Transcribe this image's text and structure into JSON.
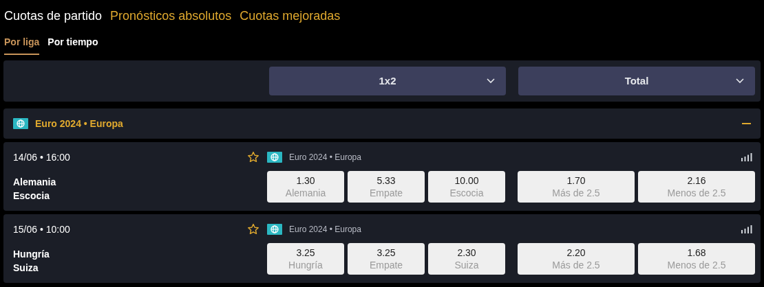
{
  "main_tabs": [
    {
      "label": "Cuotas de partido",
      "selected": true
    },
    {
      "label": "Pronósticos absolutos",
      "selected": false
    },
    {
      "label": "Cuotas mejoradas",
      "selected": false
    }
  ],
  "sub_tabs": [
    {
      "label": "Por liga",
      "selected": true
    },
    {
      "label": "Por tiempo",
      "selected": false
    }
  ],
  "market_selectors": [
    {
      "label": "1x2"
    },
    {
      "label": "Total"
    }
  ],
  "league": {
    "title": "Euro 2024 • Europa",
    "expanded": true
  },
  "matches": [
    {
      "datetime": "14/06 • 16:00",
      "league": "Euro 2024 • Europa",
      "teams": [
        "Alemania",
        "Escocia"
      ],
      "odds_1x2": [
        {
          "value": "1.30",
          "label": "Alemania"
        },
        {
          "value": "5.33",
          "label": "Empate"
        },
        {
          "value": "10.00",
          "label": "Escocia"
        }
      ],
      "odds_total": [
        {
          "value": "1.70",
          "label": "Más de 2.5"
        },
        {
          "value": "2.16",
          "label": "Menos de 2.5"
        }
      ]
    },
    {
      "datetime": "15/06 • 10:00",
      "league": "Euro 2024 • Europa",
      "teams": [
        "Hungría",
        "Suiza"
      ],
      "odds_1x2": [
        {
          "value": "3.25",
          "label": "Hungría"
        },
        {
          "value": "3.25",
          "label": "Empate"
        },
        {
          "value": "2.30",
          "label": "Suiza"
        }
      ],
      "odds_total": [
        {
          "value": "2.20",
          "label": "Más de 2.5"
        },
        {
          "value": "1.68",
          "label": "Menos de 2.5"
        }
      ]
    }
  ]
}
